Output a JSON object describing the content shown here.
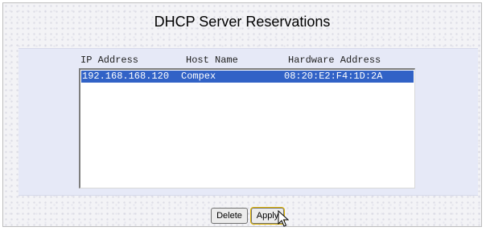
{
  "title": "DHCP Server Reservations",
  "columns": {
    "ip": "IP Address",
    "host": "Host Name",
    "hardware": "Hardware Address"
  },
  "reservations": [
    {
      "ip": "192.168.168.120",
      "host": "Compex",
      "hardware": "08:20:E2:F4:1D:2A",
      "selected": true
    }
  ],
  "buttons": {
    "delete": "Delete",
    "apply": "Apply"
  },
  "colors": {
    "panel": "#e6e9f7",
    "selection": "#3162c6"
  },
  "cursor_icon": "arrow-cursor-icon"
}
